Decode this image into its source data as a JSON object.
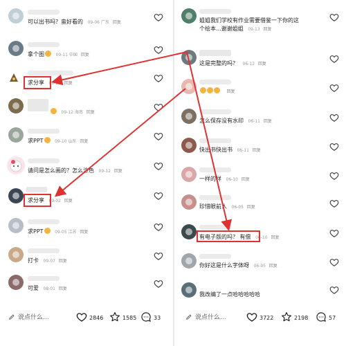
{
  "left": {
    "comments": [
      {
        "text": "可以出书吗？蛮好看的",
        "emoji": false,
        "date": "09-06",
        "region": "广东",
        "reply": "回复"
      },
      {
        "text": "拿个图",
        "emoji": true,
        "date": "09-11",
        "region": "中国",
        "reply": "回复"
      },
      {
        "text": "求分享",
        "emoji": false,
        "date": "09-22",
        "region": "",
        "reply": "回复",
        "username": "..."
      },
      {
        "text": "",
        "emoji": true,
        "date": "09-12",
        "region": "海南",
        "reply": "回复"
      },
      {
        "text": "求PPT",
        "emoji": true,
        "date": "09-10",
        "region": "山东",
        "reply": "回复"
      },
      {
        "text": "请问是怎么画的？怎么涂色",
        "emoji": false,
        "date": "09-12",
        "region": "",
        "reply": "回复"
      },
      {
        "text": "求分享",
        "emoji": false,
        "date": "09-02",
        "region": "",
        "reply": "回复"
      },
      {
        "text": "求PPT",
        "emoji": true,
        "date": "09-05",
        "region": "江苏",
        "reply": "回复"
      },
      {
        "text": "打卡",
        "emoji": false,
        "date": "09-07",
        "region": "",
        "reply": "回复"
      },
      {
        "text": "可爱",
        "emoji": false,
        "date": "08-01",
        "region": "",
        "reply": "回复"
      }
    ],
    "input_placeholder": "说点什么...",
    "likes": "2846",
    "stars": "1585",
    "comments_count": "33"
  },
  "right": {
    "comments": [
      {
        "text": "姐姐我们学校有作业需要借鉴一下你的这",
        "text2": "个绘本...谢谢姐姐",
        "emoji": false,
        "date": "09-13",
        "region": "",
        "reply": "回复"
      },
      {
        "text": "这是完整的吗？",
        "emoji": false,
        "date": "06-12",
        "region": "",
        "reply": "回复"
      },
      {
        "text": "",
        "emoji": true,
        "date": "",
        "region": "",
        "reply": "回复"
      },
      {
        "text": "怎么保存没有水印",
        "emoji": false,
        "date": "06-11",
        "region": "",
        "reply": "回复"
      },
      {
        "text": "快出书快出书",
        "emoji": false,
        "date": "06-11",
        "region": "",
        "reply": "回复"
      },
      {
        "text": "一样的样",
        "emoji": false,
        "date": "06-10",
        "region": "",
        "reply": "回复"
      },
      {
        "text": "珍惜眼前人",
        "emoji": false,
        "date": "06-05",
        "region": "",
        "reply": "回复"
      },
      {
        "text": "有电子版的吗？ 有偿",
        "emoji": false,
        "date": "06-10",
        "region": "",
        "reply": "回复"
      },
      {
        "text": "你好这是什么字体呀",
        "emoji": false,
        "date": "06-05",
        "region": "",
        "reply": "回复"
      },
      {
        "text": "我改编了一点哈哈哈哈哈",
        "emoji": false,
        "date": "",
        "region": "",
        "reply": ""
      }
    ],
    "input_placeholder": "说点什么...",
    "likes": "3722",
    "stars": "2198",
    "comments_count": "57"
  },
  "colors": {
    "highlight": "#e03131",
    "heart_outline": "#333333",
    "meta": "#9a9a9a"
  },
  "icons": [
    "heart-icon",
    "star-icon",
    "comment-icon",
    "pencil-icon"
  ]
}
